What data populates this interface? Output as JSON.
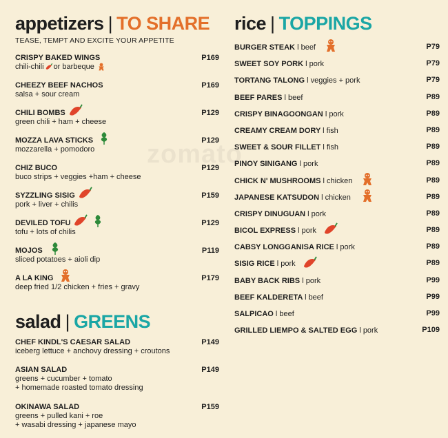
{
  "appetizers": {
    "title_main": "appetizers",
    "title_accent": "TO SHARE",
    "tagline": "TEASE, TEMPT AND EXCITE YOUR APPETITE",
    "items": [
      {
        "name": "CRISPY BAKED WINGS",
        "desc_a": "chili-chili",
        "desc_b": "or barbeque",
        "price": "P169"
      },
      {
        "name": "CHEEZY BEEF NACHOS",
        "desc": "salsa + sour cream",
        "price": "P169"
      },
      {
        "name": "CHILI BOMBS",
        "desc": "green chili + ham + cheese",
        "price": "P129"
      },
      {
        "name": "MOZZA LAVA STICKS",
        "desc": "mozzarella + pomodoro",
        "price": "P129"
      },
      {
        "name": "CHIZ BUCO",
        "desc": "buco strips + veggies +ham + cheese",
        "price": "P129"
      },
      {
        "name": "SYZZLING SISIG",
        "desc": "pork + liver + chilis",
        "price": "P159"
      },
      {
        "name": "DEVILED TOFU",
        "desc": "tofu + lots of chilis",
        "price": "P129"
      },
      {
        "name": "MOJOS",
        "desc": "sliced potatoes + aioli dip",
        "price": "P119"
      },
      {
        "name": "A LA KING",
        "desc": "deep fried 1/2 chicken + fries + gravy",
        "price": "P179"
      }
    ]
  },
  "salad": {
    "title_main": "salad",
    "title_accent": "GREENS",
    "items": [
      {
        "name": "CHEF KINDL'S CAESAR SALAD",
        "desc": "iceberg lettuce + anchovy dressing + croutons",
        "price": "P149"
      },
      {
        "name": "ASIAN SALAD",
        "desc": "greens + cucumber + tomato",
        "desc2": "+ homemade roasted tomato dressing",
        "price": "P149"
      },
      {
        "name": "OKINAWA SALAD",
        "desc": "greens + pulled kani + roe",
        "desc2": "+ wasabi dressing + japanese mayo",
        "price": "P159"
      }
    ]
  },
  "rice": {
    "title_main": "rice",
    "title_accent": "TOPPINGS",
    "items": [
      {
        "name": "BURGER STEAK",
        "cat": "l beef",
        "price": "P79"
      },
      {
        "name": "SWEET SOY PORK",
        "cat": "l pork",
        "price": "P79"
      },
      {
        "name": "TORTANG TALONG",
        "cat": "l veggies + pork",
        "price": "P79"
      },
      {
        "name": "BEEF PARES",
        "cat": "l beef",
        "price": "P89"
      },
      {
        "name": "CRISPY BINAGOONGAN",
        "cat": "l pork",
        "price": "P89"
      },
      {
        "name": "CREAMY CREAM DORY",
        "cat": "l fish",
        "price": "P89"
      },
      {
        "name": "SWEET & SOUR FILLET",
        "cat": "l fish",
        "price": "P89"
      },
      {
        "name": "PINOY SINIGANG",
        "cat": "l pork",
        "price": "P89"
      },
      {
        "name": "CHICK N' MUSHROOMS",
        "cat": "l chicken",
        "price": "P89"
      },
      {
        "name": "JAPANESE KATSUDON",
        "cat": "l chicken",
        "price": "P89"
      },
      {
        "name": "CRISPY DINUGUAN",
        "cat": "l pork",
        "price": "P89"
      },
      {
        "name": "BICOL EXPRESS",
        "cat": "l pork",
        "price": "P89"
      },
      {
        "name": "CABSY LONGGANISA RICE",
        "cat": "l pork",
        "price": "P89"
      },
      {
        "name": "SISIG RICE",
        "cat": "l pork",
        "price": "P89"
      },
      {
        "name": "BABY BACK RIBS",
        "cat": "l pork",
        "price": "P99"
      },
      {
        "name": "BEEF KALDERETA",
        "cat": "l beef",
        "price": "P99"
      },
      {
        "name": "SALPICAO",
        "cat": "l beef",
        "price": "P99"
      },
      {
        "name": "GRILLED LIEMPO & SALTED EGG",
        "cat": "l pork",
        "price": "P109"
      }
    ]
  },
  "watermark": "zomato",
  "colors": {
    "background": "#f8efd8",
    "orange": "#e36f2a",
    "teal": "#1aa6a5",
    "chili_red": "#e0442a",
    "veggie_green": "#2e8a3a"
  }
}
